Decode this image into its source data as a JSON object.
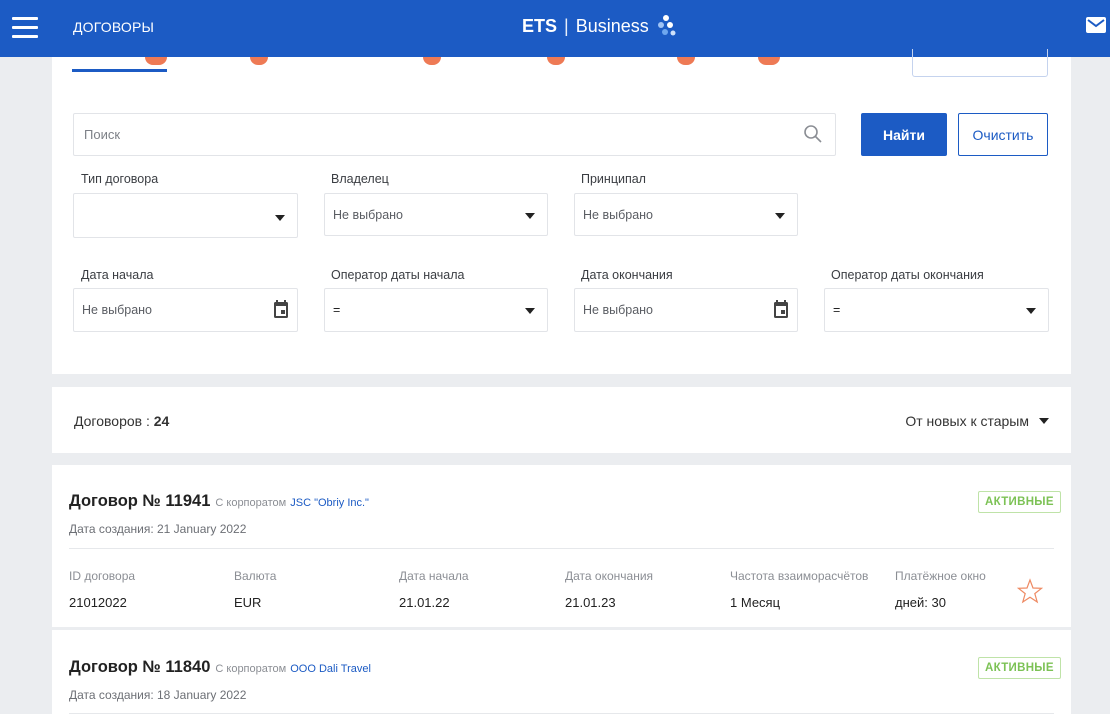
{
  "header": {
    "menu_icon": "hamburger-icon",
    "title": "ДОГОВОРЫ",
    "brand_ets": "ETS",
    "brand_sep": "|",
    "brand_business": "Business",
    "mail_icon": "mail-icon",
    "color": "#1c5bc4"
  },
  "search": {
    "placeholder": "Поиск",
    "find_label": "Найти",
    "clear_label": "Очистить"
  },
  "filters": {
    "contract_type": {
      "label": "Тип договора",
      "value": ""
    },
    "owner": {
      "label": "Владелец",
      "value": "Не выбрано"
    },
    "principal": {
      "label": "Принципал",
      "value": "Не выбрано"
    },
    "start_date": {
      "label": "Дата начала",
      "value": "Не выбрано"
    },
    "start_operator": {
      "label": "Оператор даты начала",
      "value": "="
    },
    "end_date": {
      "label": "Дата окончания",
      "value": "Не выбрано"
    },
    "end_operator": {
      "label": "Оператор даты окончания",
      "value": "="
    }
  },
  "list": {
    "count_label": "Договоров : ",
    "count": "24",
    "sort_label": "От новых к старым"
  },
  "columns": {
    "id": "ID договора",
    "currency": "Валюта",
    "start": "Дата начала",
    "end": "Дата окончания",
    "frequency": "Частота взаиморасчётов",
    "payment_window": "Платёжное окно"
  },
  "contracts": [
    {
      "title": "Договор № 11941",
      "with_label": "С корпоратом",
      "corporate": "JSC \"Obriy Inc.\"",
      "created": "Дата создания: 21 January 2022",
      "status": "АКТИВНЫЕ",
      "id": "21012022",
      "currency": "EUR",
      "start": "21.01.22",
      "end": "21.01.23",
      "frequency": "1 Месяц",
      "payment_window": "дней: 30"
    },
    {
      "title": "Договор № 11840",
      "with_label": "С корпоратом",
      "corporate": "OOO Dali Travel",
      "created": "Дата создания: 18 January 2022",
      "status": "АКТИВНЫЕ"
    }
  ],
  "colors": {
    "accent": "#1c5bc4",
    "status_active": "#7cc255",
    "tab_badge": "#ee7a55"
  }
}
